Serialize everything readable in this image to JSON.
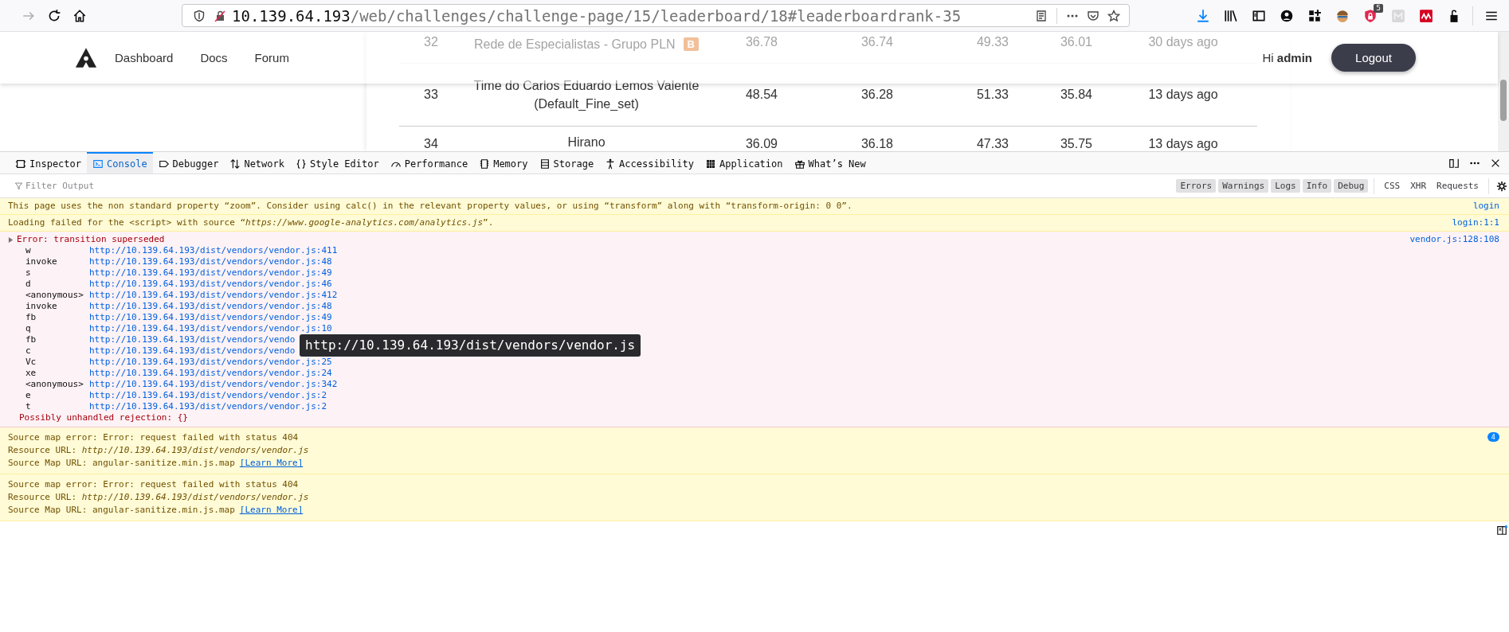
{
  "browser": {
    "url_host": "10.139.64.193",
    "url_path": "/web/challenges/challenge-page/15/leaderboard/18#leaderboardrank-35",
    "badge_count": "5"
  },
  "navbar": {
    "links": [
      "Dashboard",
      "Docs",
      "Forum"
    ],
    "greeting": "Hi **admin**",
    "logout": "Logout"
  },
  "leaderboard": {
    "rows": [
      {
        "rank": "32",
        "team": "Rede de Especialistas - Grupo PLN",
        "badge": "B",
        "scores": [
          "36.78",
          "36.74",
          "49.33",
          "36.01"
        ],
        "updated": "30 days ago"
      },
      {
        "rank": "33",
        "team": "Time do Carlos Eduardo Lemos Valente (Default_Fine_set)",
        "scores": [
          "48.54",
          "36.28",
          "51.33",
          "35.84"
        ],
        "updated": "13 days ago"
      },
      {
        "rank": "34",
        "team": "Hirano",
        "scores": [
          "36.09",
          "36.18",
          "47.33",
          "35.75"
        ],
        "updated": "13 days ago"
      }
    ]
  },
  "devtools": {
    "tabs": [
      {
        "label": "Inspector",
        "selected": false
      },
      {
        "label": "Console",
        "selected": true
      },
      {
        "label": "Debugger",
        "selected": false
      },
      {
        "label": "Network",
        "selected": false
      },
      {
        "label": "Style Editor",
        "selected": false
      },
      {
        "label": "Performance",
        "selected": false
      },
      {
        "label": "Memory",
        "selected": false
      },
      {
        "label": "Storage",
        "selected": false
      },
      {
        "label": "Accessibility",
        "selected": false
      },
      {
        "label": "Application",
        "selected": false
      },
      {
        "label": "What’s New",
        "selected": false
      }
    ],
    "filter": {
      "placeholder": "Filter Output"
    },
    "level_filters": [
      {
        "label": "Errors",
        "selected": true
      },
      {
        "label": "Warnings",
        "selected": true
      },
      {
        "label": "Logs",
        "selected": true
      },
      {
        "label": "Info",
        "selected": true
      },
      {
        "label": "Debug",
        "selected": true
      }
    ],
    "type_filters": [
      {
        "label": "CSS",
        "selected": false
      },
      {
        "label": "XHR",
        "selected": false
      },
      {
        "label": "Requests",
        "selected": false
      }
    ],
    "messages": [
      {
        "kind": "warning",
        "lines": [
          "This page uses the non standard property “zoom”. Consider using calc() in the relevant property values, or using “transform” along with “transform-origin: 0 0”."
        ],
        "source": "login"
      },
      {
        "kind": "warning",
        "lines": [
          "Loading failed for the <script> with source “*https://www.google-analytics.com/analytics.js*”."
        ],
        "source": "login:1:1"
      },
      {
        "kind": "error",
        "lines": [
          "Error: transition superseded"
        ],
        "expanded": false,
        "source": "vendor.js:128:108",
        "frames": [
          {
            "fn": "w",
            "location": "http://10.139.64.193/dist/vendors/vendor.js:411"
          },
          {
            "fn": "invoke",
            "location": "http://10.139.64.193/dist/vendors/vendor.js:48"
          },
          {
            "fn": "s",
            "location": "http://10.139.64.193/dist/vendors/vendor.js:49"
          },
          {
            "fn": "d",
            "location": "http://10.139.64.193/dist/vendors/vendor.js:46"
          },
          {
            "fn": "<anonymous>",
            "location": "http://10.139.64.193/dist/vendors/vendor.js:412"
          },
          {
            "fn": "invoke",
            "location": "http://10.139.64.193/dist/vendors/vendor.js:48"
          },
          {
            "fn": "fb",
            "location": "http://10.139.64.193/dist/vendors/vendor.js:49"
          },
          {
            "fn": "q",
            "location": "http://10.139.64.193/dist/vendors/vendor.js:10"
          },
          {
            "fn": "fb",
            "location": "http://10.139.64.193/dist/vendors/vendo"
          },
          {
            "fn": "c",
            "location": "http://10.139.64.193/dist/vendors/vendo"
          },
          {
            "fn": "Vc",
            "location": "http://10.139.64.193/dist/vendors/vendor.js:25"
          },
          {
            "fn": "xe",
            "location": "http://10.139.64.193/dist/vendors/vendor.js:24"
          },
          {
            "fn": "<anonymous>",
            "location": "http://10.139.64.193/dist/vendors/vendor.js:342"
          },
          {
            "fn": "e",
            "location": "http://10.139.64.193/dist/vendors/vendor.js:2"
          },
          {
            "fn": "t",
            "location": "http://10.139.64.193/dist/vendors/vendor.js:2"
          }
        ],
        "note": "Possibly unhandled rejection: {}",
        "tooltip": "http://10.139.64.193/dist/vendors/vendor.js"
      },
      {
        "kind": "warning",
        "lines": [
          "Source map error: Error: request failed with status 404",
          "Resource URL: *http://10.139.64.193/dist/vendors/vendor.js*",
          "Source Map URL: angular-sanitize.min.js.map"
        ],
        "link": "[Learn More]",
        "repeat": "4"
      },
      {
        "kind": "warning",
        "lines": [
          "Source map error: Error: request failed with status 404",
          "Resource URL: *http://10.139.64.193/dist/vendors/vendor.js*",
          "Source Map URL: angular-sanitize.min.js.map"
        ],
        "link": "[Learn More]"
      }
    ]
  }
}
